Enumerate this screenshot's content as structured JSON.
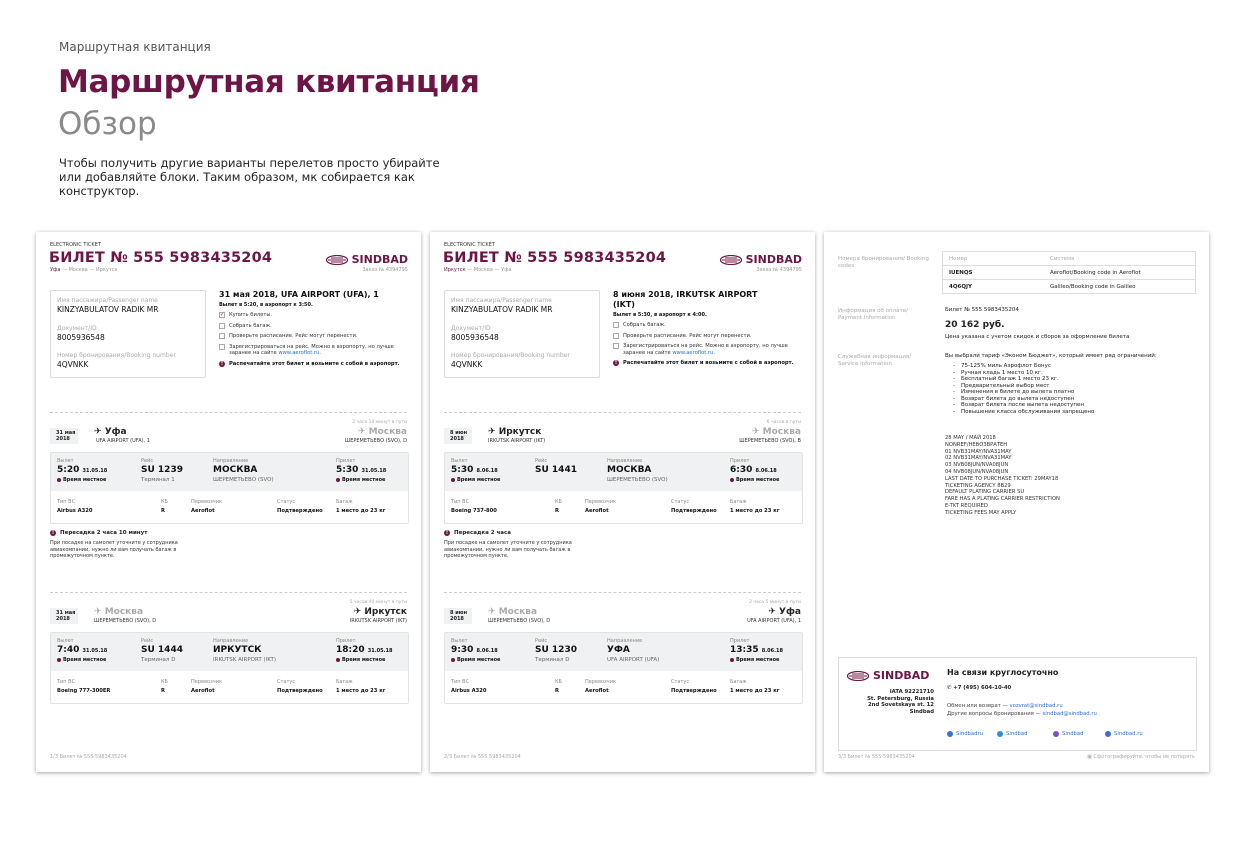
{
  "header": {
    "breadcrumb": "Маршрутная квитанция",
    "title": "Маршрутная квитанция",
    "subtitle": "Обзор",
    "intro": "Чтобы получить другие варианты перелетов просто убирайте или добавляйте блоки. Таким образом, мк собирается как конструктор."
  },
  "brand": {
    "name": "SINDBAD",
    "color": "#6d1646"
  },
  "sheets": [
    {
      "electronic_ticket": "ELECTRONIC TICKET",
      "ticket_number": "БИЛЕТ № 555 5983435204",
      "route_from": "Уфа",
      "route_rest": " — Москва — Иркутск",
      "order": "Заказ № 4394795",
      "pax_name_label": "Имя пассажира/Passenger name",
      "pax_name": "KINZYABULATOV RADIK MR",
      "doc_label": "Документ/ID",
      "doc": "8005936548",
      "booking_label": "Номер бронирования/Booking number",
      "booking": "4QVNKK",
      "todo_title": "31 мая 2018,  UFA AIRPORT (UFA), 1",
      "todo_sub": "Вылет в 5:20, в аэропорт к 3:50.",
      "todo": [
        {
          "text": "Купить билеты.",
          "checked": "✓"
        },
        {
          "text": "Собрать багаж.",
          "checked": ""
        },
        {
          "text": "Проверьте расписание. Рейс могут перенести.",
          "checked": ""
        },
        {
          "text": "Зарегистрироваться на рейс. Можно в аэропорту, но лучше заранее на сайте ",
          "link": "www.aeroflot.ru.",
          "checked": ""
        }
      ],
      "todo_alert": "Распечатайте этот билет и возьмите с собой в аэропорт.",
      "legs": [
        {
          "date": "31 мая 2018",
          "from": "Уфа",
          "from_airport": "UFA AIRPORT (UFA), 1",
          "duration": "2 часа 10 минут в пути",
          "to": "Москва",
          "to_airport": "ШЕРЕМЕТЬЕВО (SVO), D",
          "dep_label": "Вылет",
          "dep_time": "5:20",
          "dep_date": "31.05.18",
          "local": "Время местное",
          "flight_label": "Рейс",
          "flight": "SU 1239",
          "terminal": "Терминал 1",
          "dir_label": "Направление",
          "dir": "МОСКВА",
          "dir_sub": "ШЕРЕМЕТЬЕВО (SVO)",
          "arr_label": "Прилет",
          "arr_time": "5:30",
          "arr_date": "31.05.18",
          "ac_label": "Тип ВС",
          "ac": "Airbus A320",
          "cls_label": "КБ",
          "cls": "R",
          "carrier_label": "Перевозчик",
          "carrier": "Aeroflot",
          "status_label": "Статус",
          "status": "Подтверждено",
          "bag_label": "Багаж",
          "bag": "1 место до 23 кг"
        },
        {
          "date": "31 мая 2018",
          "from": "Москва",
          "from_airport": "ШЕРЕМЕТЬЕВО (SVO), D",
          "duration": "5 часов 40 минут в пути",
          "to": "Иркутск",
          "to_airport": "IRKUTSK AIRPORT (IKT)",
          "dep_label": "Вылет",
          "dep_time": "7:40",
          "dep_date": "31.05.18",
          "local": "Время местное",
          "flight_label": "Рейс",
          "flight": "SU 1444",
          "terminal": "Терминал D",
          "dir_label": "Направление",
          "dir": "ИРКУТСК",
          "dir_sub": "IRKUTSK AIRPORT (IKT)",
          "arr_label": "Прилет",
          "arr_time": "18:20",
          "arr_date": "31.05.18",
          "ac_label": "Тип ВС",
          "ac": "Boeing 777-300ER",
          "cls_label": "КБ",
          "cls": "R",
          "carrier_label": "Перевозчик",
          "carrier": "Aeroflot",
          "status_label": "Статус",
          "status": "Подтверждено",
          "bag_label": "Багаж",
          "bag": "1 место до 23 кг"
        }
      ],
      "transfer_title": "Пересадка 2 часа 10 минут",
      "transfer_text": "При посадке на самолет уточните у сотрудника авиакомпании, нужно ли вам получать багаж в промежуточном пункте.",
      "footer": "1/3   Билет № 555 5983435204"
    },
    {
      "electronic_ticket": "ELECTRONIC TICKET",
      "ticket_number": "БИЛЕТ № 555 5983435204",
      "route_from": "Иркутск",
      "route_rest": " — Москва — Уфа",
      "order": "Заказ № 4394795",
      "pax_name_label": "Имя пассажира/Passenger name",
      "pax_name": "KINZYABULATOV RADIK MR",
      "doc_label": "Документ/ID",
      "doc": "8005936548",
      "booking_label": "Номер бронирования/Booking number",
      "booking": "4QVNKK",
      "todo_title": "8 июня 2018, IRKUTSK AIRPORT (IKT)",
      "todo_sub": "Вылет в 5:30, в аэропорт к 4:00.",
      "todo": [
        {
          "text": "Собрать багаж.",
          "checked": ""
        },
        {
          "text": "Проверьте расписание. Рейс могут перенести.",
          "checked": ""
        },
        {
          "text": "Зарегистрироваться на рейс. Можно в аэропорту, но лучше заранее на сайте ",
          "link": "www.aeroflot.ru.",
          "checked": ""
        }
      ],
      "todo_alert": "Распечатайте этот билет и возьмите с собой в аэропорт.",
      "legs": [
        {
          "date": "8 июн 2018",
          "from": "Иркутск",
          "from_airport": "IRKUTSK AIRPORT (IKT)",
          "duration": "6 часов в пути",
          "to": "Москва",
          "to_airport": "ШЕРЕМЕТЬЕВО (SVO), B",
          "dep_label": "Вылет",
          "dep_time": "5:30",
          "dep_date": "8.06.18",
          "local": "Время местное",
          "flight_label": "Рейс",
          "flight": "SU 1441",
          "terminal": "",
          "dir_label": "Направление",
          "dir": "МОСКВА",
          "dir_sub": "ШЕРЕМЕТЬЕВО (SVO)",
          "arr_label": "Прилет",
          "arr_time": "6:30",
          "arr_date": "8.06.18",
          "ac_label": "Тип ВС",
          "ac": "Boeing 737-800",
          "cls_label": "КБ",
          "cls": "R",
          "carrier_label": "Перевозчик",
          "carrier": "Aeroflot",
          "status_label": "Статус",
          "status": "Подтверждено",
          "bag_label": "Багаж",
          "bag": "1 место до 23 кг"
        },
        {
          "date": "8 июн 2018",
          "from": "Москва",
          "from_airport": "ШЕРЕМЕТЬЕВО (SVO), D",
          "duration": "2 часа 5 минут в пути",
          "to": "Уфа",
          "to_airport": "UFA AIRPORT (UFA), 1",
          "dep_label": "Вылет",
          "dep_time": "9:30",
          "dep_date": "8.06.18",
          "local": "Время местное",
          "flight_label": "Рейс",
          "flight": "SU 1230",
          "terminal": "Терминал D",
          "dir_label": "Направление",
          "dir": "УФА",
          "dir_sub": "UFA AIRPORT (UFA)",
          "arr_label": "Прилет",
          "arr_time": "13:35",
          "arr_date": "8.06.18",
          "ac_label": "Тип ВС",
          "ac": "Airbus A320",
          "cls_label": "КБ",
          "cls": "R",
          "carrier_label": "Перевозчик",
          "carrier": "Aeroflot",
          "status_label": "Статус",
          "status": "Подтверждено",
          "bag_label": "Багаж",
          "bag": "1 место до 23 кг"
        }
      ],
      "transfer_title": "Пересадка 2 часа",
      "transfer_text": "При посадке на самолет уточните у сотрудника авиакомпании, нужно ли вам получать багаж в промежуточном пункте.",
      "footer": "2/3   Билет № 555 5983435204"
    }
  ],
  "info_sheet": {
    "booking_codes_label": "Номера бронирования/ Booking codes",
    "codes_head": [
      "Номер",
      "Система"
    ],
    "codes": [
      [
        "IUENQS",
        "Aeroflot/Booking code in Aeroflot"
      ],
      [
        "4Q6QJY",
        "Galileo/Booking code in Galileo"
      ]
    ],
    "payment_label": "Информация об оплате/ Payment information",
    "payment_ticket": "Билет № 555 5983435204",
    "price": "20 162 руб.",
    "price_note": "Цена указана с учетом скидок и сборов за оформление билета",
    "service_label": "Служебная информация/ Service information",
    "tariff_intro": "Вы выбрали тариф «Эконом Бюджет», который имеет ряд ограничений:",
    "tariff_items": [
      "75-125% миль Аэрофлот Бонус",
      "Ручная кладь 1 место 10 кг.",
      "Бесплатный багаж 1 место 23 кг.",
      "Предварительный выбор мест",
      "Изменения в билете до вылета платно",
      "Возврат билета до вылета недоступен",
      "Возврат билета после вылета недоступен",
      "Повышение класса обслуживания запрещено"
    ],
    "service_text": "28 MAY / МАЙ 2018\nNONREF/НЕВОЗВРАТЕН\n01 NVB31MAY/NVA31MAY\n02 NVB31MAY/NVA31MAY\n03 NVB08JUN/NVA08JUN\n04 NVB08JUN/NVA08JUN\nLAST DATE TO PURCHASE TICKET: 29MAY18\nTICKETING AGENCY 8B29\nDEFAULT PLATING CARRIER SU\nFARE HAS A PLATING CARRIER RESTRICTION\nE-TKT REQUIRED\nTICKETING FEES MAY APPLY",
    "contact": {
      "address": [
        "IATA 92221710",
        "St. Petersburg, Russia",
        "2nd Sovetskaya st. 12",
        "Sindbad"
      ],
      "headline": "На связи круглосуточно",
      "phone": "+7 (495) 604-10-40",
      "exchange_label": "Обмен или возврат — ",
      "exchange_email": "vozvrat@sindbad.ru",
      "other_label": "Другие вопросы бронирования — ",
      "other_email": "sindbad@sindbad.ru",
      "social": [
        "Sindbadru",
        "Sindbad",
        "Sindbad",
        "Sindbad.ru"
      ]
    },
    "footer": "3/3   Билет № 555 5983435204",
    "photo_note": "Сфотографируйте, чтобы не потерять"
  }
}
